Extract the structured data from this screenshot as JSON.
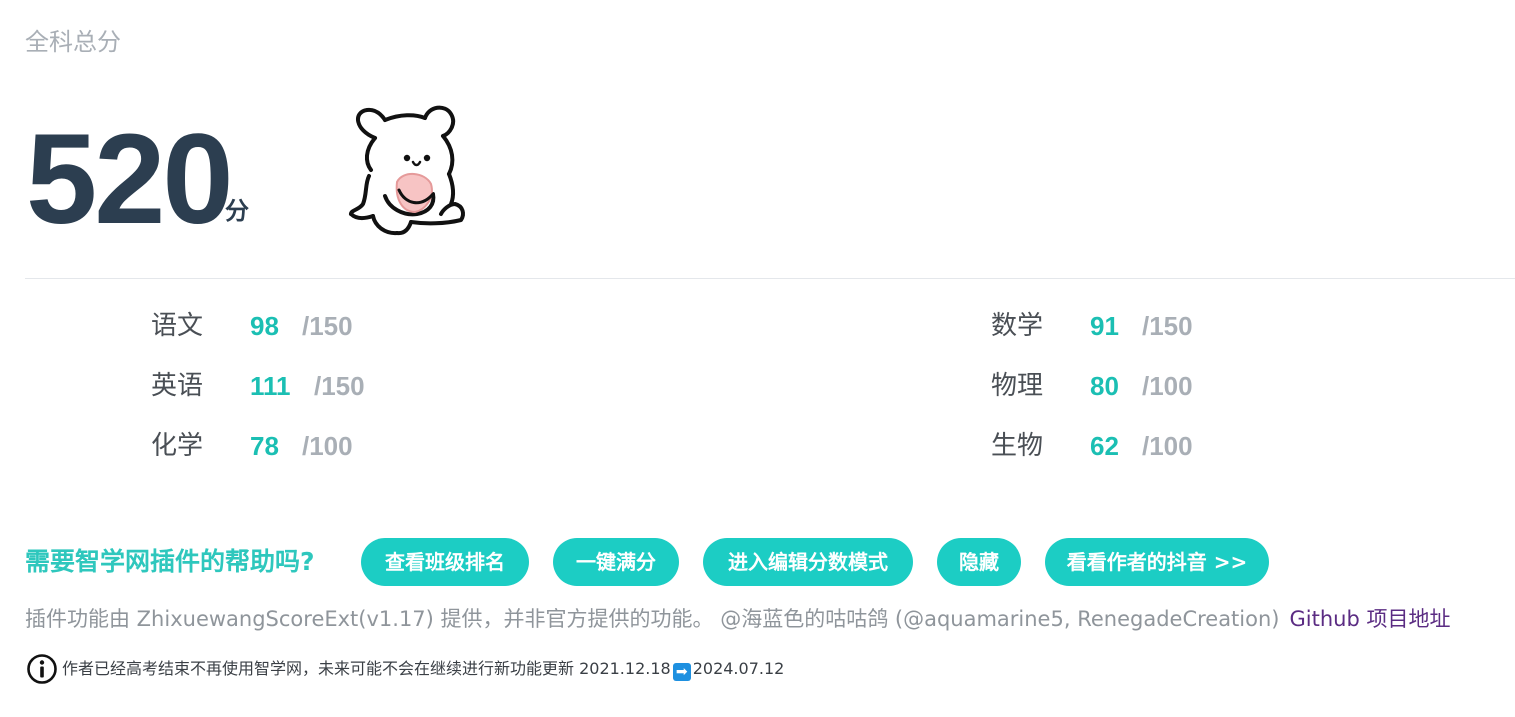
{
  "header": {
    "title": "全科总分"
  },
  "total": {
    "score": "520",
    "unit": "分"
  },
  "subjects": [
    {
      "name": "语文",
      "score": "98",
      "full": "/150"
    },
    {
      "name": "数学",
      "score": "91",
      "full": "/150"
    },
    {
      "name": "英语",
      "score": "111",
      "full": "/150"
    },
    {
      "name": "物理",
      "score": "80",
      "full": "/100"
    },
    {
      "name": "化学",
      "score": "78",
      "full": "/100"
    },
    {
      "name": "生物",
      "score": "62",
      "full": "/100"
    }
  ],
  "help": {
    "title": "需要智学网插件的帮助吗?",
    "buttons": [
      {
        "label": "查看班级排名"
      },
      {
        "label": "一键满分"
      },
      {
        "label": "进入编辑分数模式"
      },
      {
        "label": "隐藏"
      },
      {
        "label": "看看作者的抖音 >>"
      }
    ]
  },
  "credit": {
    "text": "插件功能由 ZhixuewangScoreExt(v1.17) 提供，并非官方提供的功能。 @海蓝色的咕咕鸽 (@aquamarine5, RenegadeCreation)",
    "link": "Github 项目地址"
  },
  "notice": {
    "text": "作者已经高考结束不再使用智学网，未来可能不会在继续进行新功能更新 2021.12.18",
    "arrow": "➡",
    "date": "2024.07.12"
  },
  "colors": {
    "accent": "#1ccdc4",
    "score": "#1bbfb3",
    "total": "#2c3e50",
    "muted": "#a9afb6",
    "link": "#5b2c83"
  },
  "icons": {
    "notice": "info-icon",
    "mascot": "bear-illustration"
  }
}
